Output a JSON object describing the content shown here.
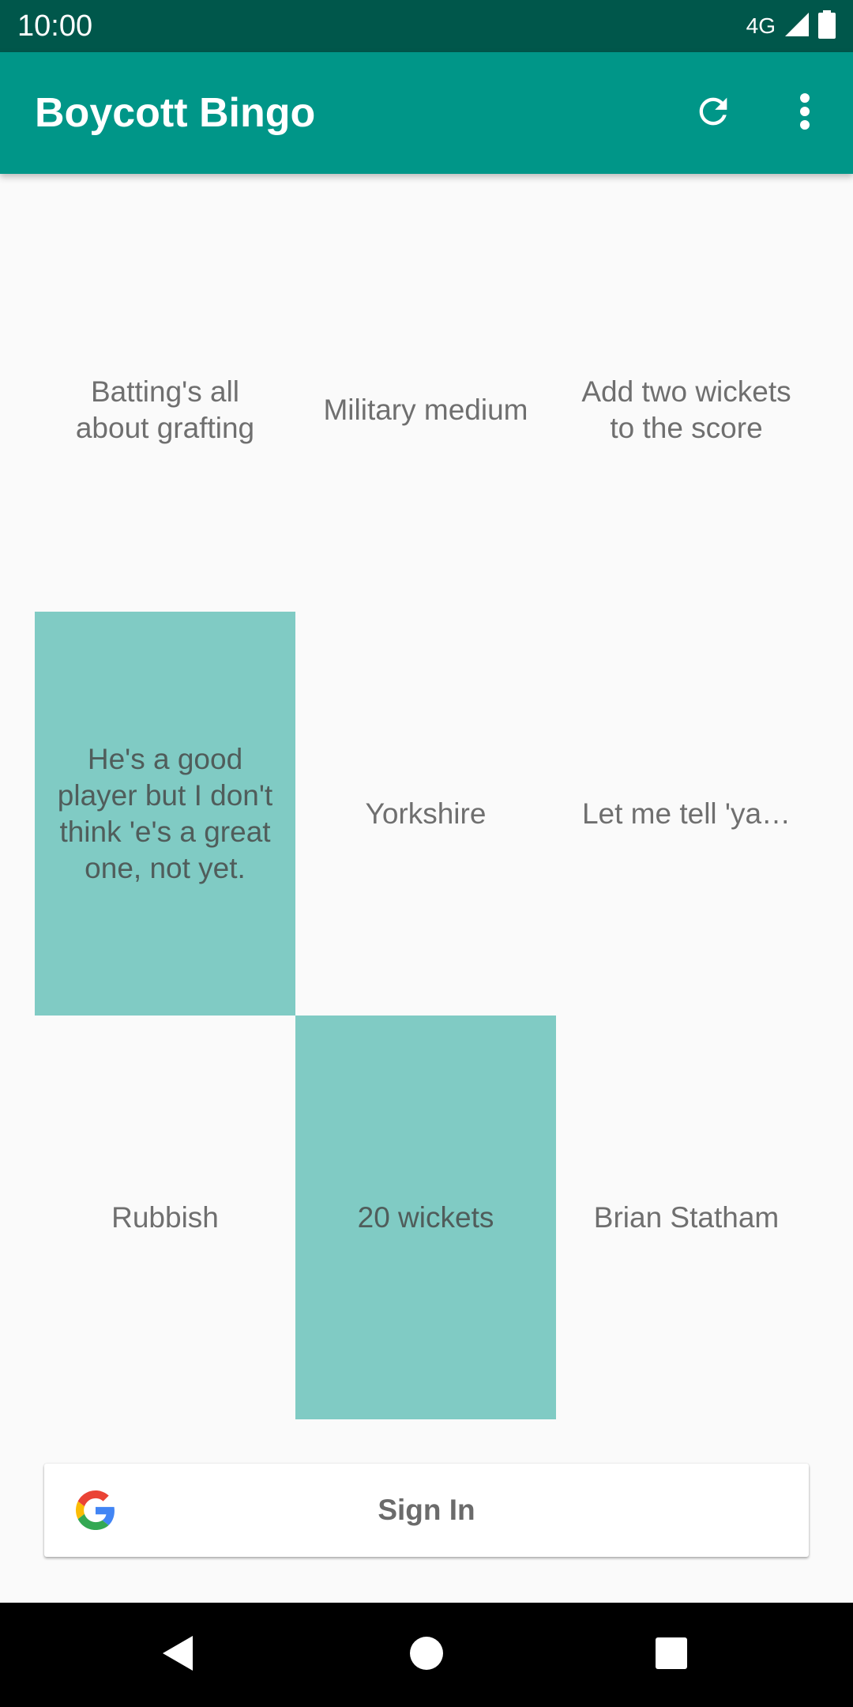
{
  "status_bar": {
    "time": "10:00",
    "network": "4G",
    "icons": [
      "signal-icon",
      "battery-icon"
    ]
  },
  "app_bar": {
    "title": "Boycott Bingo",
    "actions": [
      {
        "name": "refresh",
        "icon": "refresh-icon"
      },
      {
        "name": "more-options",
        "icon": "more-vert-icon"
      }
    ]
  },
  "board": {
    "cells": [
      {
        "label": "Batting's all about grafting",
        "marked": false
      },
      {
        "label": "Military medium",
        "marked": false
      },
      {
        "label": "Add two wickets to the score",
        "marked": false
      },
      {
        "label": "He's a good player but I don't think 'e's a great one, not yet.",
        "marked": true
      },
      {
        "label": "Yorkshire",
        "marked": false
      },
      {
        "label": "Let me tell 'ya…",
        "marked": false
      },
      {
        "label": "Rubbish",
        "marked": false
      },
      {
        "label": "20 wickets",
        "marked": true
      },
      {
        "label": "Brian Statham",
        "marked": false
      }
    ]
  },
  "signin": {
    "label": "Sign In",
    "icon": "google-icon"
  },
  "nav_bar": {
    "buttons": [
      "back-icon",
      "home-icon",
      "recents-icon"
    ]
  },
  "colors": {
    "status_bar": "#00574b",
    "app_bar": "#009688",
    "marked_cell": "#80cbc4",
    "background": "#fafafa"
  }
}
